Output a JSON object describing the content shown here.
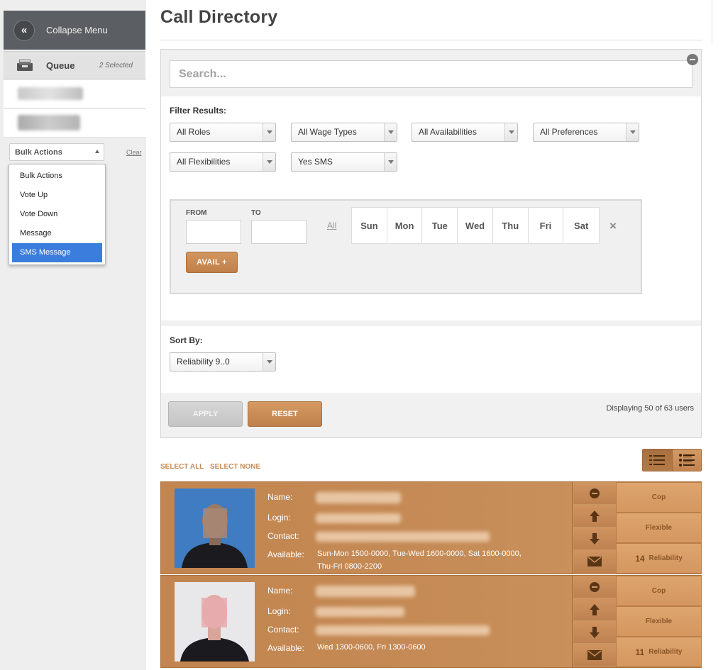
{
  "sidebar": {
    "collapse_icon": "«",
    "collapse_label": "Collapse Menu",
    "queue_label": "Queue",
    "queue_selected": "2 Selected",
    "bulk_select_value": "Bulk Actions",
    "clear_label": "Clear",
    "bulk_menu": [
      "Bulk Actions",
      "Vote Up",
      "Vote Down",
      "Message",
      "SMS Message"
    ],
    "bulk_menu_selected": "SMS Message"
  },
  "main": {
    "title": "Call Directory",
    "search_placeholder": "Search...",
    "filter_label": "Filter Results:",
    "filters": [
      "All Roles",
      "All Wage Types",
      "All Availabilities",
      "All Preferences",
      "All Flexibilities",
      "Yes SMS"
    ],
    "avail": {
      "from_label": "FROM",
      "to_label": "TO",
      "all_label": "All",
      "days": [
        "Sun",
        "Mon",
        "Tue",
        "Wed",
        "Thu",
        "Fri",
        "Sat"
      ],
      "clear_icon": "×",
      "avail_button": "AVAIL +"
    },
    "sort_label": "Sort By:",
    "sort_value": "Reliability 9..0",
    "apply_label": "APPLY",
    "reset_label": "RESET",
    "displaying": "Displaying 50 of 63 users",
    "select_all": "SELECT ALL",
    "select_none": "SELECT NONE"
  },
  "card_labels": {
    "name": "Name:",
    "login": "Login:",
    "contact": "Contact:",
    "available": "Available:"
  },
  "users": [
    {
      "available_line1": "Sun-Mon 1500-0000, Tue-Wed 1600-0000, Sat 1600-0000,",
      "available_line2": "Thu-Fri 0800-2200",
      "role": "Cop",
      "flex": "Flexible",
      "reliability_num": "14",
      "reliability_label": "Reliability"
    },
    {
      "available_line1": "Wed 1300-0600, Fri 1300-0600",
      "available_line2": "",
      "role": "Cop",
      "flex": "Flexible",
      "reliability_num": "11",
      "reliability_label": "Reliability"
    }
  ],
  "colors": {
    "accent": "#c88a52",
    "sidebar_dark": "#5b5e62",
    "menu_highlight": "#3b7ddd"
  }
}
